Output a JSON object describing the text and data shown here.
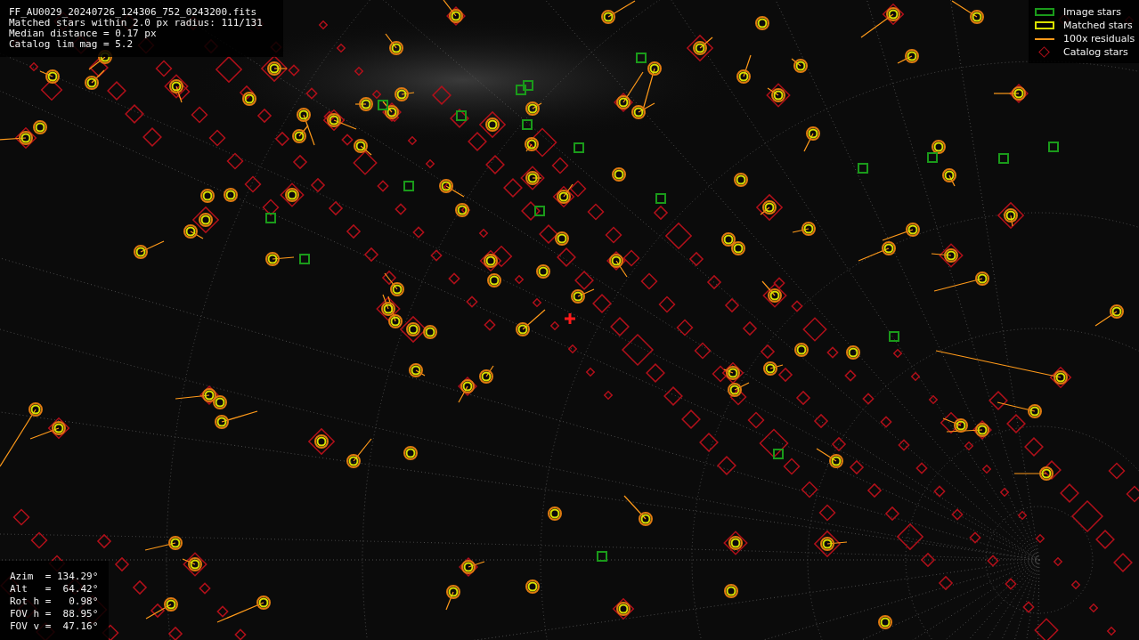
{
  "header": {
    "lines": [
      "FF_AU0029_20240726_124306_752_0243200.fits",
      "Matched stars within 2.0 px radius: 111/131",
      "Median distance = 0.17 px",
      "Catalog lim mag = 5.2"
    ]
  },
  "legend": [
    {
      "kind": "image",
      "label": "Image stars"
    },
    {
      "kind": "matched",
      "label": "Matched stars"
    },
    {
      "kind": "residual",
      "label": "100x residuals"
    },
    {
      "kind": "catalog",
      "label": "Catalog stars"
    }
  ],
  "camera_info": {
    "lines": [
      "Azim  = 134.29°",
      "Alt   =  64.42°",
      "Rot h =   0.98°",
      "FOV h =  88.95°",
      "FOV v =  47.16°"
    ]
  }
}
